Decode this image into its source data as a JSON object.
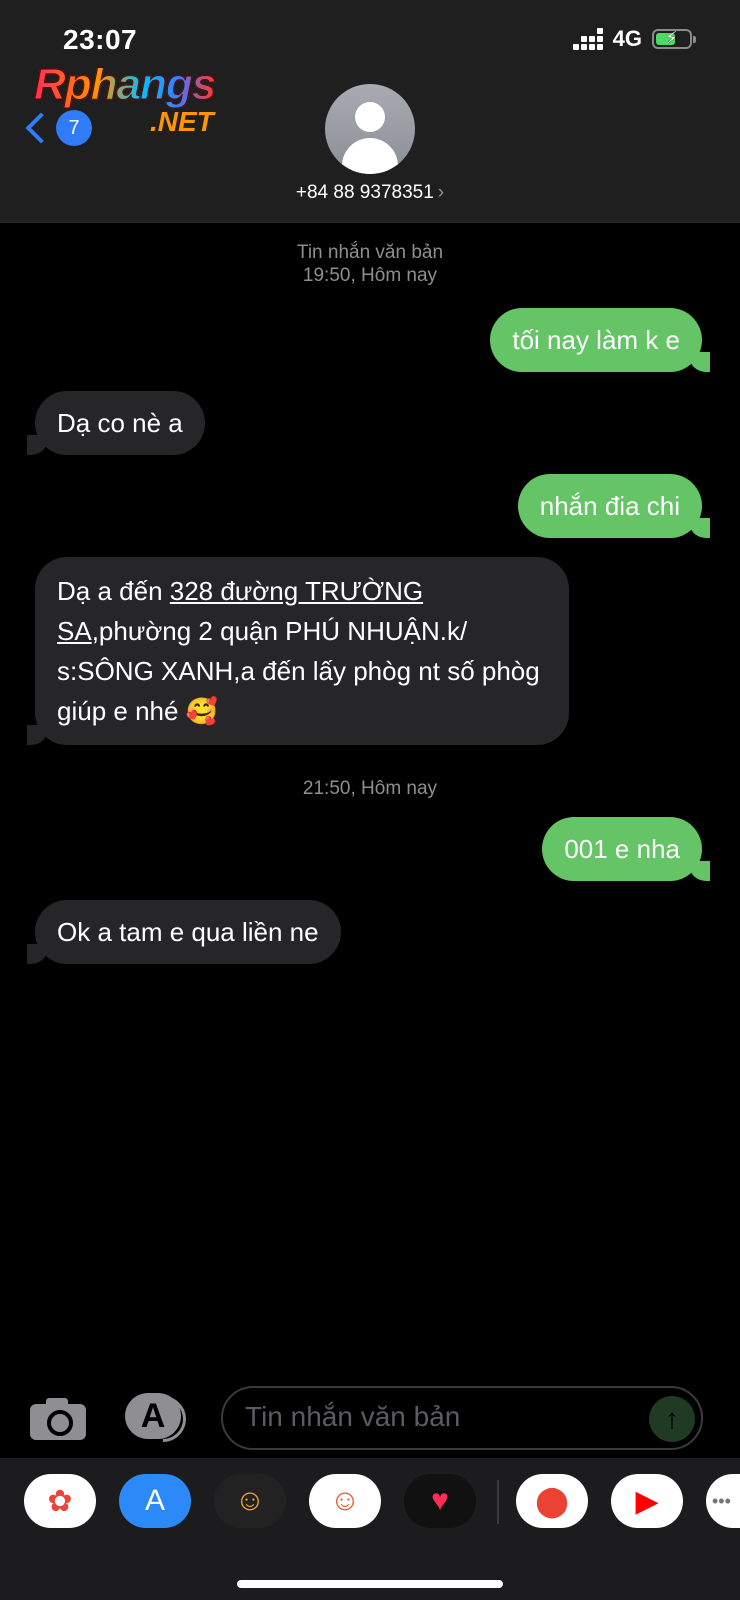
{
  "status": {
    "time": "23:07",
    "network": "4G",
    "battery_level": 0.6
  },
  "logo": {
    "main": "Rphangs",
    "suffix": ".NET"
  },
  "nav": {
    "back_count": "7"
  },
  "contact": {
    "name": "+84 88 9378351",
    "arrow": "›"
  },
  "thread": {
    "ts1_label": "Tin nhắn văn bản",
    "ts1_time": "19:50, Hôm nay",
    "msg1": "tối nay làm k e",
    "msg2": "Dạ co nè a",
    "msg3": "nhắn đia chi",
    "msg4_pre": "Dạ a đến ",
    "msg4_link1": "328 đường TRƯỜNG",
    "msg4_link2": "SA",
    "msg4_post": ",phường 2 quận PHÚ NHUẬN.k/ s:SÔNG XANH,a đến lấy phòg nt số phòg giúp e nhé 🥰",
    "ts2_time": "21:50, Hôm nay",
    "msg5": "001 e nha",
    "msg6": "Ok a tam e qua liền ne"
  },
  "composer": {
    "placeholder": "Tin nhắn văn bản",
    "send_glyph": "↑",
    "apps_glyph": "A"
  },
  "drawer": {
    "apps": [
      {
        "name": "photos-icon",
        "glyph": "✿",
        "bg": "#ffffff",
        "color": "#e8453c"
      },
      {
        "name": "app-store-icon",
        "glyph": "A",
        "bg": "#2b8af7",
        "color": "#ffffff"
      },
      {
        "name": "memoji-icon",
        "glyph": "☺",
        "bg": "#222222",
        "color": "#f0a040"
      },
      {
        "name": "memoji-stickers-icon",
        "glyph": "☺",
        "bg": "#ffffff",
        "color": "#e85a30"
      },
      {
        "name": "digital-touch-icon",
        "glyph": "♥",
        "bg": "#111111",
        "color": "#ff2d55"
      },
      {
        "name": "google-maps-icon",
        "glyph": "⬤",
        "bg": "#ffffff",
        "color": "#ea4335"
      },
      {
        "name": "youtube-icon",
        "glyph": "▶",
        "bg": "#ffffff",
        "color": "#ff0000"
      },
      {
        "name": "more-apps-icon",
        "glyph": "•••",
        "bg": "#ffffff",
        "color": "#777777"
      }
    ]
  }
}
